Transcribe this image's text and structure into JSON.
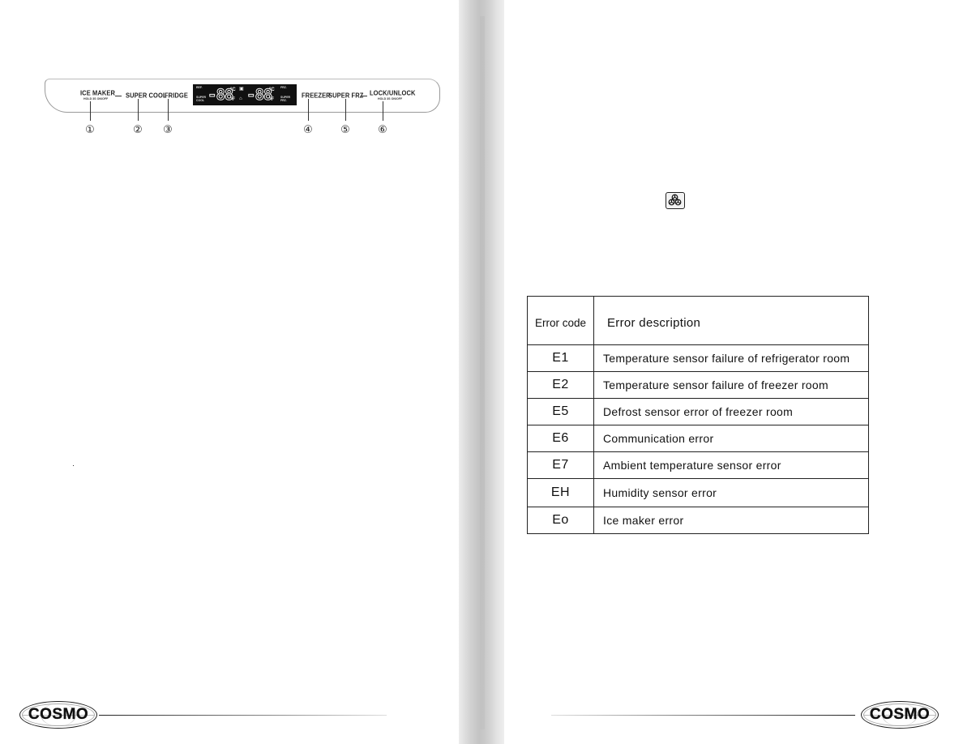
{
  "control_panel": {
    "buttons": [
      {
        "id": 1,
        "label": "ICE MAKER",
        "sublabel": "HOLD 3S ON/OFF",
        "callout": "①"
      },
      {
        "id": 2,
        "label": "SUPER COOL",
        "sublabel": "",
        "callout": "②"
      },
      {
        "id": 3,
        "label": "FRIDGE",
        "sublabel": "",
        "callout": "③"
      },
      {
        "id": 4,
        "label": "FREEZER",
        "sublabel": "",
        "callout": "④"
      },
      {
        "id": 5,
        "label": "SUPER FRZ",
        "sublabel": "",
        "callout": "⑤"
      },
      {
        "id": 6,
        "label": "LOCK/UNLOCK",
        "sublabel": "HOLD 3S ON/OFF",
        "callout": "⑥"
      }
    ],
    "display": {
      "left": {
        "top_label": "REF.",
        "bottom_label": "SUPER COOL",
        "digits": "-88",
        "unit_c": "°C",
        "unit_f": "°F"
      },
      "right": {
        "top_label": "FRZ.",
        "bottom_label": "SUPER FRZ.",
        "digits": "-88",
        "unit_c": "°C",
        "unit_f": "°F"
      },
      "center_icons": [
        "ice-maker-icon",
        "lock-icon"
      ]
    }
  },
  "icons": {
    "ice_maker": "ice-cubes-icon"
  },
  "error_table": {
    "headers": {
      "code": "Error code",
      "description": "Error description"
    },
    "rows": [
      {
        "code": "E1",
        "description": "Temperature sensor failure of refrigerator room"
      },
      {
        "code": "E2",
        "description": "Temperature sensor failure of freezer room"
      },
      {
        "code": "E5",
        "description": "Defrost  sensor error of freezer room"
      },
      {
        "code": "E6",
        "description": "Communication error"
      },
      {
        "code": "E7",
        "description": "Ambient temperature sensor error"
      },
      {
        "code": "EH",
        "description": "Humidity sensor error"
      },
      {
        "code": "Eo",
        "description": "Ice maker  error"
      }
    ]
  },
  "footer": {
    "brand": "COSMO"
  }
}
